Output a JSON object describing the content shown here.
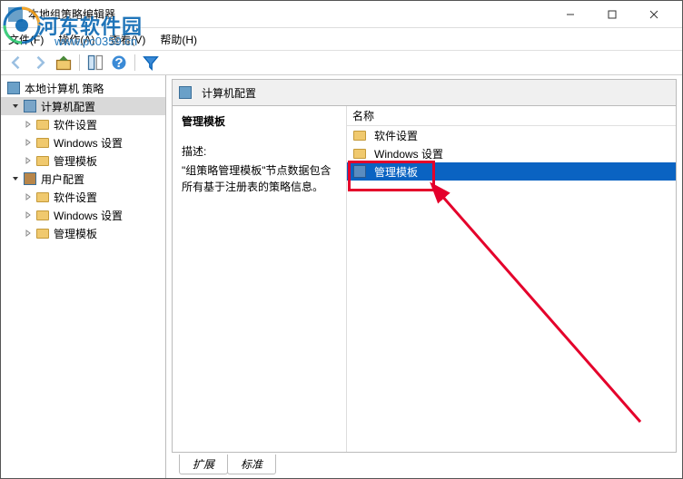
{
  "window": {
    "title": "本地组策略编辑器"
  },
  "menu": {
    "file": "文件(F)",
    "action": "操作(A)",
    "view": "查看(V)",
    "help": "帮助(H)"
  },
  "tree": {
    "root": "本地计算机 策略",
    "computer": "计算机配置",
    "c_soft": "软件设置",
    "c_win": "Windows 设置",
    "c_admin": "管理模板",
    "user": "用户配置",
    "u_soft": "软件设置",
    "u_win": "Windows 设置",
    "u_admin": "管理模板"
  },
  "header": {
    "title": "计算机配置"
  },
  "left_pane": {
    "title": "管理模板",
    "sub": "描述:",
    "desc": "\"组策略管理模板\"节点数据包含所有基于注册表的策略信息。"
  },
  "right_pane": {
    "col": "名称",
    "r1": "软件设置",
    "r2": "Windows 设置",
    "r3": "管理模板"
  },
  "tabs": {
    "t1": "扩展",
    "t2": "标准"
  },
  "watermark": {
    "name": "河东软件园",
    "url": "www.pc0359.cn"
  }
}
